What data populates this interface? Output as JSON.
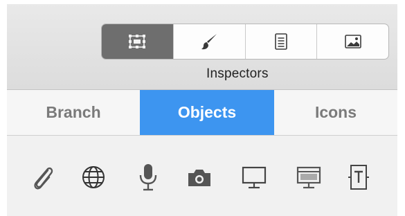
{
  "inspectors": {
    "label": "Inspectors",
    "segments": [
      {
        "icon": "object-inspector-icon",
        "active": true
      },
      {
        "icon": "brush-icon",
        "active": false
      },
      {
        "icon": "document-icon",
        "active": false
      },
      {
        "icon": "canvas-image-icon",
        "active": false
      }
    ]
  },
  "tabs": [
    {
      "label": "Branch",
      "active": false
    },
    {
      "label": "Objects",
      "active": true
    },
    {
      "label": "Icons",
      "active": false
    }
  ],
  "objects": [
    {
      "icon": "paperclip-icon"
    },
    {
      "icon": "globe-icon"
    },
    {
      "icon": "microphone-icon"
    },
    {
      "icon": "camera-icon"
    },
    {
      "icon": "monitor-icon"
    },
    {
      "icon": "presentation-icon"
    },
    {
      "icon": "text-box-icon"
    }
  ],
  "colors": {
    "accent": "#3d95f0",
    "active_segment": "#6e6e6e",
    "icon": "#555555"
  }
}
